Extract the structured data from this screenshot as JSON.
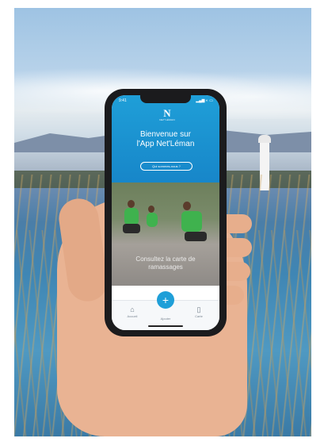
{
  "status": {
    "time": "9:41",
    "icons": "▂▄▆ ◐ ▭"
  },
  "app": {
    "logo_mark": "N",
    "logo_sub": "NET'LÉMAN",
    "welcome_line1": "Bienvenue sur",
    "welcome_line2": "l'App Net'Léman",
    "pill_label": "Qui sommes-nous ?",
    "hero_caption_line1": "Consultez la carte de",
    "hero_caption_line2": "ramassages"
  },
  "tabbar": {
    "tab_left": "Accueil",
    "tab_center": "+",
    "tab_center_label": "Ajouter",
    "tab_right": "Carte",
    "icon_left": "home-icon",
    "icon_center": "plus-icon",
    "icon_right": "map-icon"
  },
  "colors": {
    "accent": "#1f9fd8",
    "header_dark": "#1786c9",
    "tab_bg": "#f6f8fa"
  }
}
